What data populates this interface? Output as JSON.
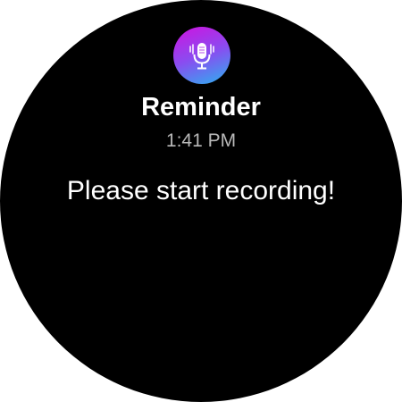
{
  "notification": {
    "icon": "microphone-icon",
    "icon_gradient": [
      "#d012e0",
      "#8a4cf0",
      "#2bb2f0"
    ],
    "title": "Reminder",
    "time": "1:41 PM",
    "message": "Please start recording!"
  }
}
